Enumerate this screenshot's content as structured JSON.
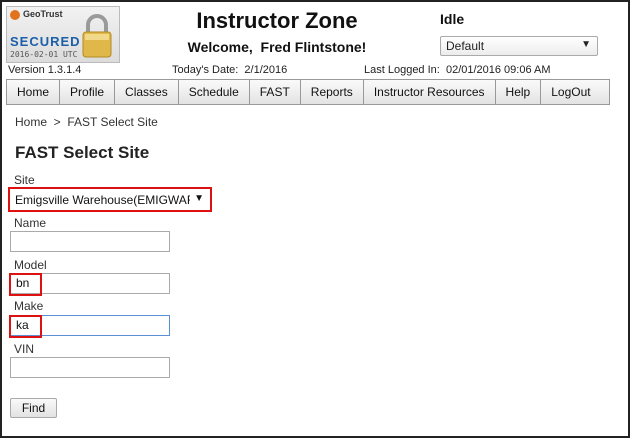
{
  "badge": {
    "brand": "GeoTrust",
    "secured": "SECURED",
    "date": "2016-02-01 UTC"
  },
  "header": {
    "title": "Instructor Zone",
    "welcome": "Welcome,  Fred Flintstone!",
    "status": "Idle",
    "profile_select": "Default"
  },
  "info": {
    "version": "Version 1.3.1.4",
    "todays_date": "Today's Date:  2/1/2016",
    "last_logged": "Last Logged In:  02/01/2016 09:06 AM"
  },
  "nav": {
    "items": [
      "Home",
      "Profile",
      "Classes",
      "Schedule",
      "FAST",
      "Reports",
      "Instructor Resources",
      "Help",
      "LogOut"
    ]
  },
  "breadcrumb": "Home  >  FAST Select Site",
  "page_title": "FAST Select Site",
  "form": {
    "site_label": "Site",
    "site_value": "Emigsville Warehouse(EMIGWAR",
    "name_label": "Name",
    "name_value": "",
    "model_label": "Model",
    "model_value": "bn",
    "make_label": "Make",
    "make_value": "ka",
    "vin_label": "VIN",
    "vin_value": "",
    "find_button": "Find"
  },
  "colors": {
    "highlight": "#dd1111",
    "focus": "#5b8fd6",
    "secured_text": "#1b5fa8"
  }
}
